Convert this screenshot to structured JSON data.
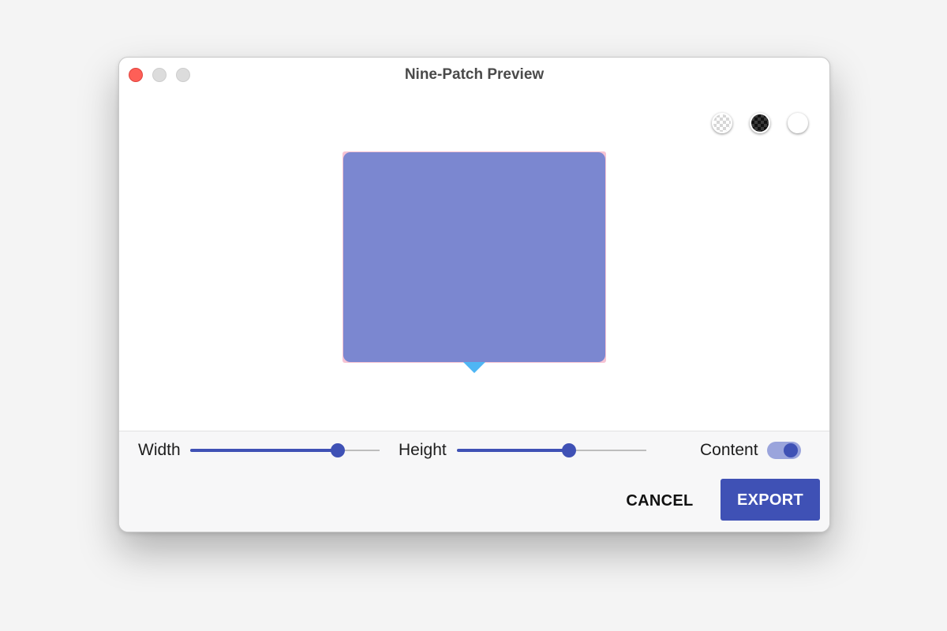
{
  "window": {
    "title": "Nine-Patch Preview"
  },
  "background_options": [
    {
      "name": "checkerboard-light",
      "selected": false
    },
    {
      "name": "checkerboard-dark",
      "selected": true
    },
    {
      "name": "white",
      "selected": false
    }
  ],
  "preview": {
    "fill_color": "#7b87d0",
    "outline_color": "#f6c3d3",
    "tail_color": "#4fb6f4"
  },
  "controls": {
    "width": {
      "label": "Width",
      "value_fraction": 0.78
    },
    "height": {
      "label": "Height",
      "value_fraction": 0.59
    },
    "content": {
      "label": "Content",
      "enabled": true
    }
  },
  "buttons": {
    "cancel": "CANCEL",
    "export": "EXPORT"
  },
  "colors": {
    "accent": "#3f51b5",
    "close": "#fe5f57",
    "toggle_track": "#9aa4dc"
  }
}
